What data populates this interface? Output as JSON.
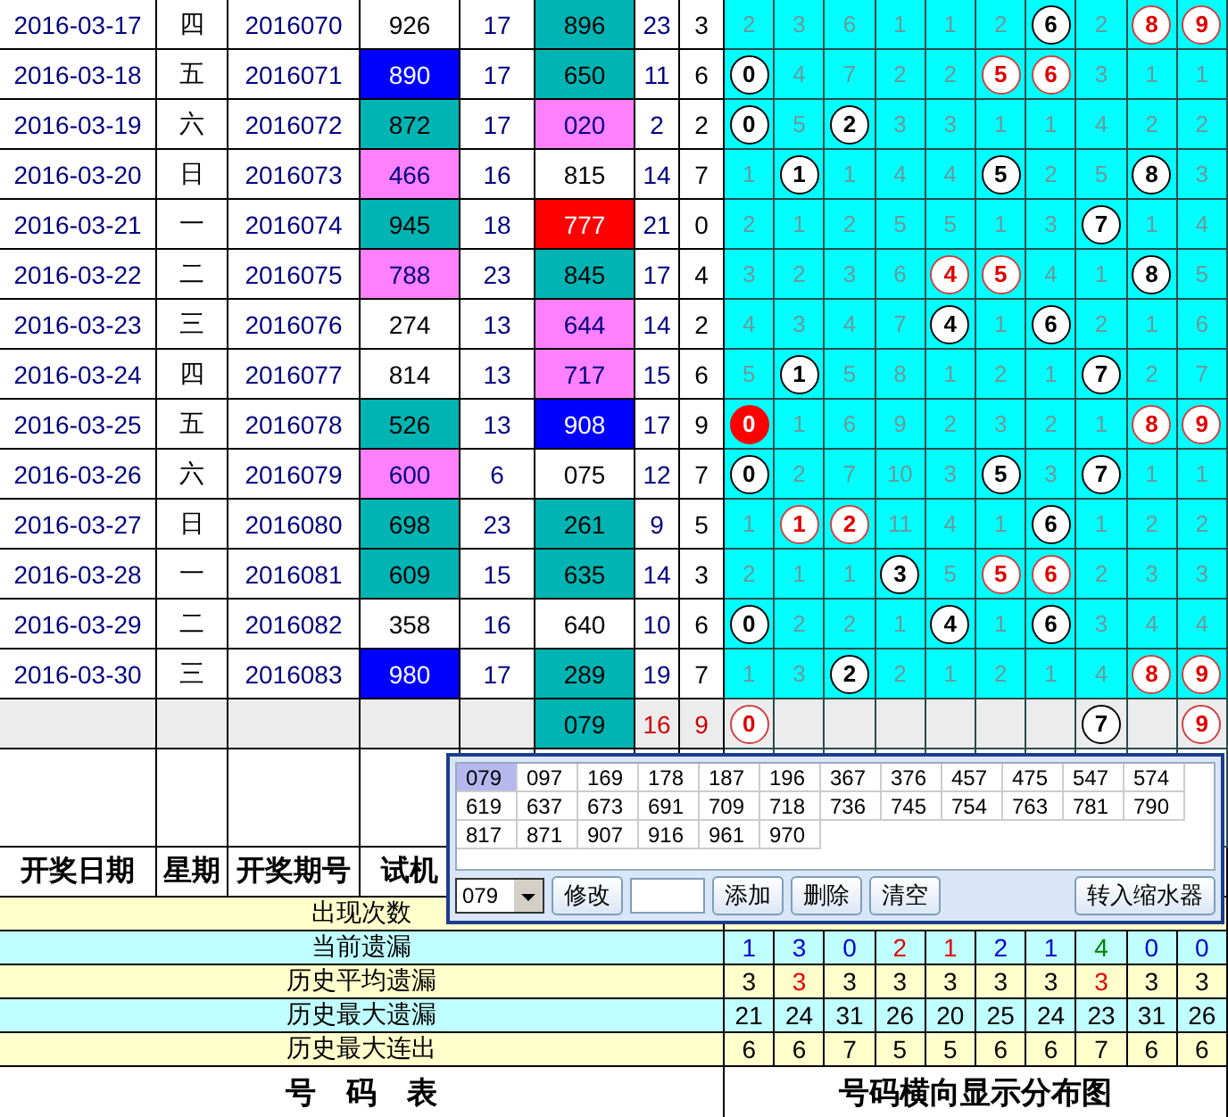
{
  "rows": [
    {
      "kind": "draw",
      "date": "2016-03-17",
      "weekday": "四",
      "issue": "2016070",
      "test": {
        "value": "926",
        "color": "#ffffff"
      },
      "test_sum": "17",
      "draw": {
        "value": "896",
        "color": "#00b4b4"
      },
      "sum": "23",
      "span": "3",
      "digits": [
        {
          "kind": "miss",
          "text": "2"
        },
        {
          "kind": "miss",
          "text": "3"
        },
        {
          "kind": "miss",
          "text": "6"
        },
        {
          "kind": "miss",
          "text": "1"
        },
        {
          "kind": "miss",
          "text": "1"
        },
        {
          "kind": "miss",
          "text": "2"
        },
        {
          "kind": "ball",
          "text": "6"
        },
        {
          "kind": "miss",
          "text": "2"
        },
        {
          "kind": "ball-red",
          "text": "8"
        },
        {
          "kind": "ball-red",
          "text": "9"
        }
      ]
    },
    {
      "kind": "draw",
      "date": "2016-03-18",
      "weekday": "五",
      "issue": "2016071",
      "test": {
        "value": "890",
        "color": "#0000ff"
      },
      "test_sum": "17",
      "draw": {
        "value": "650",
        "color": "#00b4b4"
      },
      "sum": "11",
      "span": "6",
      "digits": [
        {
          "kind": "ball",
          "text": "0"
        },
        {
          "kind": "miss",
          "text": "4"
        },
        {
          "kind": "miss",
          "text": "7"
        },
        {
          "kind": "miss",
          "text": "2"
        },
        {
          "kind": "miss",
          "text": "2"
        },
        {
          "kind": "ball-red",
          "text": "5"
        },
        {
          "kind": "ball-red",
          "text": "6"
        },
        {
          "kind": "miss",
          "text": "3"
        },
        {
          "kind": "miss",
          "text": "1"
        },
        {
          "kind": "miss",
          "text": "1"
        }
      ]
    },
    {
      "kind": "draw",
      "date": "2016-03-19",
      "weekday": "六",
      "issue": "2016072",
      "test": {
        "value": "872",
        "color": "#00b4b4"
      },
      "test_sum": "17",
      "draw": {
        "value": "020",
        "color": "#ff80ff"
      },
      "sum": "2",
      "span": "2",
      "digits": [
        {
          "kind": "ball",
          "text": "0"
        },
        {
          "kind": "miss",
          "text": "5"
        },
        {
          "kind": "ball",
          "text": "2"
        },
        {
          "kind": "miss",
          "text": "3"
        },
        {
          "kind": "miss",
          "text": "3"
        },
        {
          "kind": "miss",
          "text": "1"
        },
        {
          "kind": "miss",
          "text": "1"
        },
        {
          "kind": "miss",
          "text": "4"
        },
        {
          "kind": "miss",
          "text": "2"
        },
        {
          "kind": "miss",
          "text": "2"
        }
      ]
    },
    {
      "kind": "draw",
      "date": "2016-03-20",
      "weekday": "日",
      "issue": "2016073",
      "test": {
        "value": "466",
        "color": "#ff80ff"
      },
      "test_sum": "16",
      "draw": {
        "value": "815",
        "color": "#ffffff"
      },
      "sum": "14",
      "span": "7",
      "digits": [
        {
          "kind": "miss",
          "text": "1"
        },
        {
          "kind": "ball",
          "text": "1"
        },
        {
          "kind": "miss",
          "text": "1"
        },
        {
          "kind": "miss",
          "text": "4"
        },
        {
          "kind": "miss",
          "text": "4"
        },
        {
          "kind": "ball",
          "text": "5"
        },
        {
          "kind": "miss",
          "text": "2"
        },
        {
          "kind": "miss",
          "text": "5"
        },
        {
          "kind": "ball",
          "text": "8"
        },
        {
          "kind": "miss",
          "text": "3"
        }
      ]
    },
    {
      "kind": "draw",
      "date": "2016-03-21",
      "weekday": "一",
      "issue": "2016074",
      "test": {
        "value": "945",
        "color": "#00b4b4"
      },
      "test_sum": "18",
      "draw": {
        "value": "777",
        "color": "#ff0000"
      },
      "sum": "21",
      "span": "0",
      "digits": [
        {
          "kind": "miss",
          "text": "2"
        },
        {
          "kind": "miss",
          "text": "1"
        },
        {
          "kind": "miss",
          "text": "2"
        },
        {
          "kind": "miss",
          "text": "5"
        },
        {
          "kind": "miss",
          "text": "5"
        },
        {
          "kind": "miss",
          "text": "1"
        },
        {
          "kind": "miss",
          "text": "3"
        },
        {
          "kind": "ball",
          "text": "7"
        },
        {
          "kind": "miss",
          "text": "1"
        },
        {
          "kind": "miss",
          "text": "4"
        }
      ]
    },
    {
      "kind": "draw",
      "date": "2016-03-22",
      "weekday": "二",
      "issue": "2016075",
      "test": {
        "value": "788",
        "color": "#ff80ff"
      },
      "test_sum": "23",
      "draw": {
        "value": "845",
        "color": "#00b4b4"
      },
      "sum": "17",
      "span": "4",
      "digits": [
        {
          "kind": "miss",
          "text": "3"
        },
        {
          "kind": "miss",
          "text": "2"
        },
        {
          "kind": "miss",
          "text": "3"
        },
        {
          "kind": "miss",
          "text": "6"
        },
        {
          "kind": "ball-red",
          "text": "4"
        },
        {
          "kind": "ball-red",
          "text": "5"
        },
        {
          "kind": "miss",
          "text": "4"
        },
        {
          "kind": "miss",
          "text": "1"
        },
        {
          "kind": "ball",
          "text": "8"
        },
        {
          "kind": "miss",
          "text": "5"
        }
      ]
    },
    {
      "kind": "draw",
      "date": "2016-03-23",
      "weekday": "三",
      "issue": "2016076",
      "test": {
        "value": "274",
        "color": "#ffffff"
      },
      "test_sum": "13",
      "draw": {
        "value": "644",
        "color": "#ff80ff"
      },
      "sum": "14",
      "span": "2",
      "digits": [
        {
          "kind": "miss",
          "text": "4"
        },
        {
          "kind": "miss",
          "text": "3"
        },
        {
          "kind": "miss",
          "text": "4"
        },
        {
          "kind": "miss",
          "text": "7"
        },
        {
          "kind": "ball",
          "text": "4"
        },
        {
          "kind": "miss",
          "text": "1"
        },
        {
          "kind": "ball",
          "text": "6"
        },
        {
          "kind": "miss",
          "text": "2"
        },
        {
          "kind": "miss",
          "text": "1"
        },
        {
          "kind": "miss",
          "text": "6"
        }
      ]
    },
    {
      "kind": "draw",
      "date": "2016-03-24",
      "weekday": "四",
      "issue": "2016077",
      "test": {
        "value": "814",
        "color": "#ffffff"
      },
      "test_sum": "13",
      "draw": {
        "value": "717",
        "color": "#ff80ff"
      },
      "sum": "15",
      "span": "6",
      "digits": [
        {
          "kind": "miss",
          "text": "5"
        },
        {
          "kind": "ball",
          "text": "1"
        },
        {
          "kind": "miss",
          "text": "5"
        },
        {
          "kind": "miss",
          "text": "8"
        },
        {
          "kind": "miss",
          "text": "1"
        },
        {
          "kind": "miss",
          "text": "2"
        },
        {
          "kind": "miss",
          "text": "1"
        },
        {
          "kind": "ball",
          "text": "7"
        },
        {
          "kind": "miss",
          "text": "2"
        },
        {
          "kind": "miss",
          "text": "7"
        }
      ]
    },
    {
      "kind": "draw",
      "date": "2016-03-25",
      "weekday": "五",
      "issue": "2016078",
      "test": {
        "value": "526",
        "color": "#00b4b4"
      },
      "test_sum": "13",
      "draw": {
        "value": "908",
        "color": "#0000ff"
      },
      "sum": "17",
      "span": "9",
      "digits": [
        {
          "kind": "ball-solid",
          "text": "0"
        },
        {
          "kind": "miss",
          "text": "1"
        },
        {
          "kind": "miss",
          "text": "6"
        },
        {
          "kind": "miss",
          "text": "9"
        },
        {
          "kind": "miss",
          "text": "2"
        },
        {
          "kind": "miss",
          "text": "3"
        },
        {
          "kind": "miss",
          "text": "2"
        },
        {
          "kind": "miss",
          "text": "1"
        },
        {
          "kind": "ball-red",
          "text": "8"
        },
        {
          "kind": "ball-red",
          "text": "9"
        }
      ]
    },
    {
      "kind": "draw",
      "date": "2016-03-26",
      "weekday": "六",
      "issue": "2016079",
      "test": {
        "value": "600",
        "color": "#ff80ff"
      },
      "test_sum": "6",
      "draw": {
        "value": "075",
        "color": "#ffffff"
      },
      "sum": "12",
      "span": "7",
      "digits": [
        {
          "kind": "ball",
          "text": "0"
        },
        {
          "kind": "miss",
          "text": "2"
        },
        {
          "kind": "miss",
          "text": "7"
        },
        {
          "kind": "miss",
          "text": "10"
        },
        {
          "kind": "miss",
          "text": "3"
        },
        {
          "kind": "ball",
          "text": "5"
        },
        {
          "kind": "miss",
          "text": "3"
        },
        {
          "kind": "ball",
          "text": "7"
        },
        {
          "kind": "miss",
          "text": "1"
        },
        {
          "kind": "miss",
          "text": "1"
        }
      ]
    },
    {
      "kind": "draw",
      "date": "2016-03-27",
      "weekday": "日",
      "issue": "2016080",
      "test": {
        "value": "698",
        "color": "#00b4b4"
      },
      "test_sum": "23",
      "draw": {
        "value": "261",
        "color": "#00b4b4"
      },
      "sum": "9",
      "span": "5",
      "digits": [
        {
          "kind": "miss",
          "text": "1"
        },
        {
          "kind": "ball-red",
          "text": "1"
        },
        {
          "kind": "ball-red",
          "text": "2"
        },
        {
          "kind": "miss",
          "text": "11"
        },
        {
          "kind": "miss",
          "text": "4"
        },
        {
          "kind": "miss",
          "text": "1"
        },
        {
          "kind": "ball",
          "text": "6"
        },
        {
          "kind": "miss",
          "text": "1"
        },
        {
          "kind": "miss",
          "text": "2"
        },
        {
          "kind": "miss",
          "text": "2"
        }
      ]
    },
    {
      "kind": "draw",
      "date": "2016-03-28",
      "weekday": "一",
      "issue": "2016081",
      "test": {
        "value": "609",
        "color": "#00b4b4"
      },
      "test_sum": "15",
      "draw": {
        "value": "635",
        "color": "#00b4b4"
      },
      "sum": "14",
      "span": "3",
      "digits": [
        {
          "kind": "miss",
          "text": "2"
        },
        {
          "kind": "miss",
          "text": "1"
        },
        {
          "kind": "miss",
          "text": "1"
        },
        {
          "kind": "ball",
          "text": "3"
        },
        {
          "kind": "miss",
          "text": "5"
        },
        {
          "kind": "ball-red",
          "text": "5"
        },
        {
          "kind": "ball-red",
          "text": "6"
        },
        {
          "kind": "miss",
          "text": "2"
        },
        {
          "kind": "miss",
          "text": "3"
        },
        {
          "kind": "miss",
          "text": "3"
        }
      ]
    },
    {
      "kind": "draw",
      "date": "2016-03-29",
      "weekday": "二",
      "issue": "2016082",
      "test": {
        "value": "358",
        "color": "#ffffff"
      },
      "test_sum": "16",
      "draw": {
        "value": "640",
        "color": "#ffffff"
      },
      "sum": "10",
      "span": "6",
      "digits": [
        {
          "kind": "ball",
          "text": "0"
        },
        {
          "kind": "miss",
          "text": "2"
        },
        {
          "kind": "miss",
          "text": "2"
        },
        {
          "kind": "miss",
          "text": "1"
        },
        {
          "kind": "ball",
          "text": "4"
        },
        {
          "kind": "miss",
          "text": "1"
        },
        {
          "kind": "ball",
          "text": "6"
        },
        {
          "kind": "miss",
          "text": "3"
        },
        {
          "kind": "miss",
          "text": "4"
        },
        {
          "kind": "miss",
          "text": "4"
        }
      ]
    },
    {
      "kind": "draw",
      "date": "2016-03-30",
      "weekday": "三",
      "issue": "2016083",
      "test": {
        "value": "980",
        "color": "#0000ff"
      },
      "test_sum": "17",
      "draw": {
        "value": "289",
        "color": "#00b4b4"
      },
      "sum": "19",
      "span": "7",
      "digits": [
        {
          "kind": "miss",
          "text": "1"
        },
        {
          "kind": "miss",
          "text": "3"
        },
        {
          "kind": "ball",
          "text": "2"
        },
        {
          "kind": "miss",
          "text": "2"
        },
        {
          "kind": "miss",
          "text": "1"
        },
        {
          "kind": "miss",
          "text": "2"
        },
        {
          "kind": "miss",
          "text": "1"
        },
        {
          "kind": "miss",
          "text": "4"
        },
        {
          "kind": "ball-red",
          "text": "8"
        },
        {
          "kind": "ball-red",
          "text": "9"
        }
      ]
    },
    {
      "kind": "forecast",
      "draw": {
        "value": "079",
        "color": "#00b4b4"
      },
      "sum": "16",
      "span": "9",
      "digits": [
        {
          "kind": "ball-red",
          "text": "0"
        },
        {
          "kind": "empty"
        },
        {
          "kind": "empty"
        },
        {
          "kind": "empty"
        },
        {
          "kind": "empty"
        },
        {
          "kind": "empty"
        },
        {
          "kind": "empty"
        },
        {
          "kind": "ball",
          "text": "7"
        },
        {
          "kind": "empty"
        },
        {
          "kind": "ball-red",
          "text": "9"
        }
      ]
    }
  ],
  "header": [
    "开奖日期",
    "星期",
    "开奖期号",
    "试机"
  ],
  "stats": [
    {
      "label": "出现次数",
      "color": "#ffffcc"
    },
    {
      "label": "当前遗漏",
      "color": "#c0ffff",
      "values": [
        {
          "text": "1",
          "color": "#0000cc"
        },
        {
          "text": "3",
          "color": "#0000cc"
        },
        {
          "text": "0",
          "color": "#0000cc"
        },
        {
          "text": "2",
          "color": "#e00000"
        },
        {
          "text": "1",
          "color": "#e00000"
        },
        {
          "text": "2",
          "color": "#0000cc"
        },
        {
          "text": "1",
          "color": "#0000cc"
        },
        {
          "text": "4",
          "color": "#008000"
        },
        {
          "text": "0",
          "color": "#0000cc"
        },
        {
          "text": "0",
          "color": "#0000cc"
        }
      ]
    },
    {
      "label": "历史平均遗漏",
      "color": "#ffffcc",
      "values": [
        {
          "text": "3",
          "color": "#000000"
        },
        {
          "text": "3",
          "color": "#e00000"
        },
        {
          "text": "3",
          "color": "#000000"
        },
        {
          "text": "3",
          "color": "#000000"
        },
        {
          "text": "3",
          "color": "#000000"
        },
        {
          "text": "3",
          "color": "#000000"
        },
        {
          "text": "3",
          "color": "#000000"
        },
        {
          "text": "3",
          "color": "#e00000"
        },
        {
          "text": "3",
          "color": "#000000"
        },
        {
          "text": "3",
          "color": "#000000"
        }
      ]
    },
    {
      "label": "历史最大遗漏",
      "color": "#c0ffff",
      "values": [
        {
          "text": "21",
          "color": "#000000"
        },
        {
          "text": "24",
          "color": "#000000"
        },
        {
          "text": "31",
          "color": "#000000"
        },
        {
          "text": "26",
          "color": "#000000"
        },
        {
          "text": "20",
          "color": "#000000"
        },
        {
          "text": "25",
          "color": "#000000"
        },
        {
          "text": "24",
          "color": "#000000"
        },
        {
          "text": "23",
          "color": "#000000"
        },
        {
          "text": "31",
          "color": "#000000"
        },
        {
          "text": "26",
          "color": "#000000"
        }
      ]
    },
    {
      "label": "历史最大连出",
      "color": "#ffffcc",
      "values": [
        {
          "text": "6",
          "color": "#000000"
        },
        {
          "text": "6",
          "color": "#000000"
        },
        {
          "text": "7",
          "color": "#000000"
        },
        {
          "text": "5",
          "color": "#000000"
        },
        {
          "text": "5",
          "color": "#000000"
        },
        {
          "text": "6",
          "color": "#000000"
        },
        {
          "text": "6",
          "color": "#000000"
        },
        {
          "text": "7",
          "color": "#000000"
        },
        {
          "text": "6",
          "color": "#000000"
        },
        {
          "text": "6",
          "color": "#000000"
        }
      ]
    }
  ],
  "footer": [
    "号　码　表",
    "号码横向显示分布图"
  ],
  "popup": {
    "numbers": [
      {
        "text": "079",
        "selected": true
      },
      {
        "text": "097",
        "selected": false
      },
      {
        "text": "169",
        "selected": false
      },
      {
        "text": "178",
        "selected": false
      },
      {
        "text": "187",
        "selected": false
      },
      {
        "text": "196",
        "selected": false
      },
      {
        "text": "367",
        "selected": false
      },
      {
        "text": "376",
        "selected": false
      },
      {
        "text": "457",
        "selected": false
      },
      {
        "text": "475",
        "selected": false
      },
      {
        "text": "547",
        "selected": false
      },
      {
        "text": "574",
        "selected": false
      },
      {
        "text": "619",
        "selected": false
      },
      {
        "text": "637",
        "selected": false
      },
      {
        "text": "673",
        "selected": false
      },
      {
        "text": "691",
        "selected": false
      },
      {
        "text": "709",
        "selected": false
      },
      {
        "text": "718",
        "selected": false
      },
      {
        "text": "736",
        "selected": false
      },
      {
        "text": "745",
        "selected": false
      },
      {
        "text": "754",
        "selected": false
      },
      {
        "text": "763",
        "selected": false
      },
      {
        "text": "781",
        "selected": false
      },
      {
        "text": "790",
        "selected": false
      },
      {
        "text": "817",
        "selected": false
      },
      {
        "text": "871",
        "selected": false
      },
      {
        "text": "907",
        "selected": false
      },
      {
        "text": "916",
        "selected": false
      },
      {
        "text": "961",
        "selected": false
      },
      {
        "text": "970",
        "selected": false
      }
    ],
    "combo": "079",
    "buttons": [
      "修改",
      "添加",
      "删除",
      "清空",
      "转入缩水器"
    ]
  }
}
